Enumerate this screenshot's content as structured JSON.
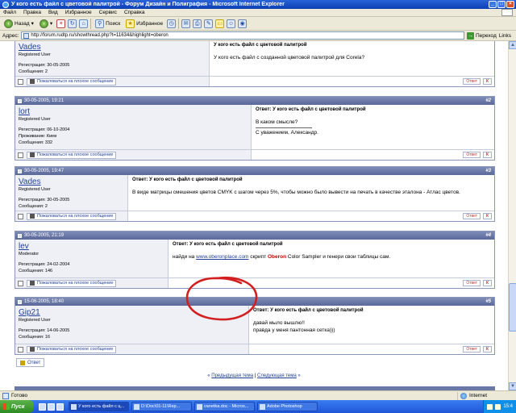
{
  "window": {
    "title": "У кого есть файл с цветовой палитрой - Форум Дизайн и Полиграфия - Microsoft Internet Explorer",
    "minimize": "_",
    "maximize": "□",
    "close": "×"
  },
  "menu": [
    "Файл",
    "Правка",
    "Вид",
    "Избранное",
    "Сервис",
    "Справка"
  ],
  "toolbar": {
    "back": "Назад",
    "search": "Поиск",
    "favorites": "Избранное"
  },
  "address": {
    "label": "Адрес:",
    "url": "http://forum.rudtp.ru/showthread.php?t=11634&highlight=oberon",
    "go": "Переход",
    "links": "Links"
  },
  "posts": [
    {
      "date": "",
      "number": "",
      "user": "Vades",
      "role": "Registered User",
      "info": [
        "Регистрация: 30-05-2005",
        "Сообщения: 2"
      ],
      "subject": "У кого есть файл с цветовой палитрой",
      "lines": [
        "У кого есть файл с созданной цветовой палитрой для Corela?"
      ]
    },
    {
      "date": "30-05-2005, 19:21",
      "number": "#2",
      "user": "lort",
      "role": "Registered User",
      "info": [
        "Регистрация: 06-10-2004",
        "Проживание: Киев",
        "Сообщения: 332"
      ],
      "subject": "Ответ: У кого есть файл с цветовой палитрой",
      "lines": [
        "В каком смысле?"
      ],
      "signature": "С уважением, Александр."
    },
    {
      "date": "30-05-2005, 19:47",
      "number": "#3",
      "user": "Vades",
      "role": "Registered User",
      "info": [
        "Регистрация: 30-05-2005",
        "Сообщения: 2"
      ],
      "subject": "Ответ: У кого есть файл с цветовой палитрой",
      "lines": [
        "В виде матрицы смешения цветов CMYK с шагом через 5%, чтобы можно было вывести на печать в качестве эталона - Атлас цветов."
      ]
    },
    {
      "date": "30-05-2005, 21:19",
      "number": "#4",
      "user": "lev",
      "role": "Moderator",
      "info": [
        "Регистрация: 24-02-2004",
        "Сообщения: 146"
      ],
      "subject": "Ответ: У кого есть файл с цветовой палитрой",
      "rich": {
        "pre": "найди на ",
        "link": "www.oberonplace.com",
        "mid": " скрипт ",
        "highlight": "Oberon",
        "post": " Color Sampler и генери свои таблицы сам."
      }
    },
    {
      "date": "15-06-2005, 18:40",
      "number": "#5",
      "user": "Gip21",
      "role": "Registered User",
      "info": [
        "Регистрация: 14-06-2005",
        "Сообщения: 16"
      ],
      "subject": "Ответ: У кого есть файл с цветовой палитрой",
      "lines": [
        "давай мыло вышлю!!",
        "правда у меня пантонная сетка)))"
      ]
    }
  ],
  "post_actions": {
    "report": "Пожаловаться на плохое сообщение",
    "quote": "Ответ",
    "quick": "К"
  },
  "reply_button": "Ответ",
  "thread_nav": {
    "prev": "Предыдущая тема",
    "separator": " | ",
    "next": "Следующая тема"
  },
  "status": {
    "text": "Готово",
    "zone": "Internet"
  },
  "taskbar": {
    "start": "Пуск",
    "tasks": [
      "У кого есть файл с ц...",
      "D:\\Doc\\01-11\\Rep...",
      "vanetka.doc - Micros...",
      "Adobe Photoshop"
    ],
    "clock": "15:4"
  },
  "colors": {
    "post_header": "#5a689a",
    "annotation_circle": "#d21f1f",
    "highlight": "#c00000",
    "link": "#22409a"
  }
}
